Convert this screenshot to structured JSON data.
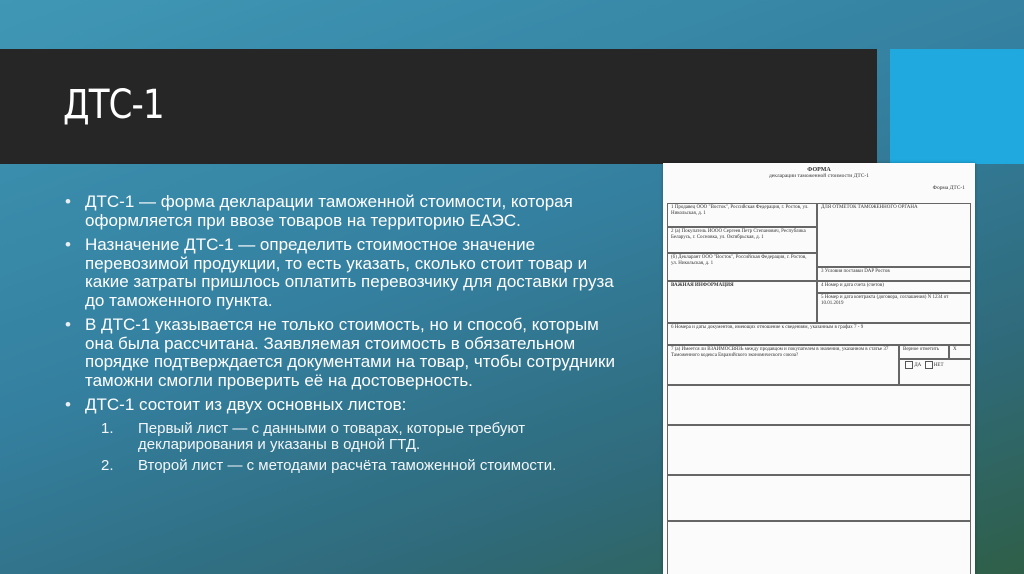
{
  "slide": {
    "title": "ДТС-1",
    "bullets": [
      "ДТС-1 — форма декларации таможенной стоимости, которая оформляется при ввозе товаров на территорию ЕАЭС.",
      "Назначение ДТС-1 — определить стоимостное значение перевозимой продукции, то есть указать, сколько стоит товар и какие затраты пришлось оплатить перевозчику для доставки груза до таможенного пункта.",
      "В ДТС-1 указывается не только стоимость, но и способ, которым она была рассчитана. Заявляемая стоимость в обязательном порядке подтверждается документами на товар, чтобы сотрудники таможни смогли проверить её на достоверность.",
      "ДТС-1 состоит из двух основных листов:"
    ],
    "sub_items": [
      {
        "num": "1.",
        "text": "Первый лист — с данными о товарах, которые требуют декларирования и указаны в одной ГТД."
      },
      {
        "num": "2.",
        "text": "Второй лист — с методами расчёта таможенной стоимости."
      }
    ]
  },
  "form_image": {
    "heading": "ФОРМА",
    "subheading": "декларации таможенной стоимости ДТС-1",
    "form_label": "Форма ДТС-1",
    "cells": {
      "c1": "1  Продавец ООО \"Восток\", Российская Федерация, г. Ростов, ул. Никольская, д. 1",
      "c2a": "2  (а) Покупатель ИООО Сергеев Петр Степанович, Республика Беларусь, г. Сосновка, ул. Октябрьская, д. 1",
      "c2b": "(б) Декларант ООО \"Восток\", Российская Федерация, г. Ростов, ул. Никольская, д. 1",
      "customs": "ДЛЯ ОТМЕТОК ТАМОЖЕННОГО ОРГАНА",
      "c3": "3  Условия поставки DAP Ростов",
      "important": "ВАЖНАЯ ИНФОРМАЦИЯ",
      "c4": "4  Номер и дата счета (счетов)",
      "c5": "5  Номер и дата контракта (договора, соглашения) N 1234 от 10.01.2019",
      "c6": "6  Номера и даты документов, имеющих отношение к сведениям, указанным в графах 7 - 9",
      "c7": "7  (а) Имеется ли ВЗАИМОСВЯЗЬ между продавцом и покупателем в значении, указанном в статье 37 Таможенного кодекса Евразийского экономического союза?",
      "answer": "Верное отметить",
      "x": "X",
      "yes": "ДА",
      "no": "НЕТ"
    }
  }
}
